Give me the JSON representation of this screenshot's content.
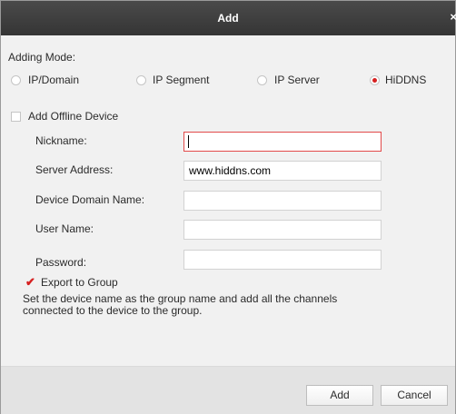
{
  "window": {
    "title": "Add",
    "close_glyph": "×"
  },
  "adding_mode": {
    "label": "Adding Mode:",
    "options": [
      "IP/Domain",
      "IP Segment",
      "IP Server",
      "HiDDNS"
    ],
    "selected": "HiDDNS"
  },
  "offline": {
    "label": "Add Offline Device",
    "checked": false
  },
  "fields": {
    "nickname": {
      "label": "Nickname:",
      "value": ""
    },
    "server_address": {
      "label": "Server Address:",
      "value": "www.hiddns.com"
    },
    "device_domain_name": {
      "label": "Device Domain Name:",
      "value": ""
    },
    "user_name": {
      "label": "User Name:",
      "value": ""
    },
    "password": {
      "label": "Password:",
      "value": ""
    }
  },
  "export": {
    "label": "Export to Group",
    "checked": true,
    "check_glyph": "✔"
  },
  "description": "Set the device name as the group name and add all the channels connected to the device to the group.",
  "buttons": {
    "add": "Add",
    "cancel": "Cancel"
  },
  "colors": {
    "accent": "#d62020",
    "titlebar": "#3d3d3d",
    "focus_border": "#e24a4a"
  }
}
